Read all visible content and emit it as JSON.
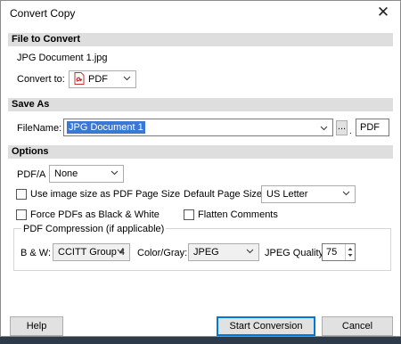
{
  "window": {
    "title": "Convert Copy",
    "close_glyph": "✕"
  },
  "file_section": {
    "header": "File to Convert",
    "filename": "JPG Document 1.jpg",
    "convert_to_label": "Convert to:",
    "convert_to_value": "PDF"
  },
  "save_section": {
    "header": "Save As",
    "filename_label": "FileName:",
    "filename_value": "JPG Document 1",
    "browse_label": "...",
    "separator": ".",
    "extension": "PDF"
  },
  "options_section": {
    "header": "Options",
    "pdfa_label": "PDF/A",
    "pdfa_value": "None",
    "use_image_size_label": "Use image size as PDF Page Size",
    "use_image_size_checked": false,
    "default_page_size_label": "Default Page Size:",
    "default_page_size_value": "US Letter",
    "force_bw_label": "Force PDFs as Black & White",
    "force_bw_checked": false,
    "flatten_label": "Flatten Comments",
    "flatten_checked": false,
    "compression": {
      "group_label": "PDF Compression (if applicable)",
      "bw_label": "B & W:",
      "bw_value": "CCITT Group 4",
      "color_label": "Color/Gray:",
      "color_value": "JPEG",
      "quality_label": "JPEG Quality:",
      "quality_value": "75"
    }
  },
  "buttons": {
    "help": "Help",
    "start": "Start Conversion",
    "cancel": "Cancel"
  },
  "colors": {
    "selection": "#3b78d6",
    "section_header": "#dedede",
    "primary_border": "#0078d7"
  }
}
